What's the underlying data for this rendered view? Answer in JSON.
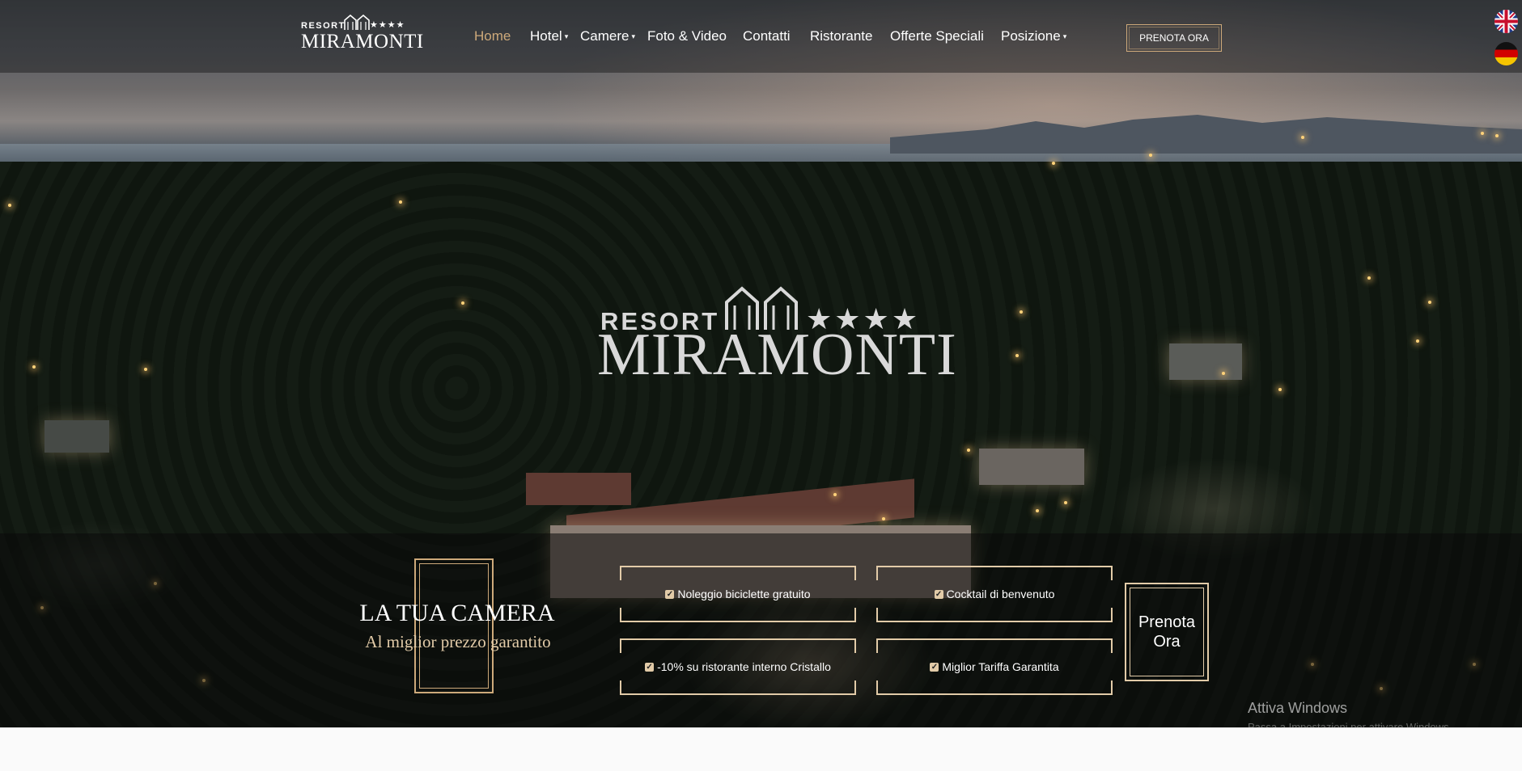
{
  "brand": {
    "resort": "RESORT",
    "stars": "★★★★",
    "name": "MIRAMONTI"
  },
  "nav": {
    "home": "Home",
    "hotel": "Hotel",
    "camere": "Camere",
    "foto": "Foto & Video",
    "contatti": "Contatti",
    "ristorante": "Ristorante",
    "offerte": "Offerte Speciali",
    "posizione": "Posizione",
    "caret": "▾",
    "book_label": "PRENOTA ORA"
  },
  "hero_logo": {
    "resort": "RESORT",
    "stars": "★★★★",
    "name": "MIRAMONTI"
  },
  "promo": {
    "title": "LA TUA CAMERA",
    "subtitle": "Al miglior prezzo garantito",
    "perks": [
      "Noleggio biciclette gratuito",
      "Cocktail di benvenuto",
      "-10% su ristorante interno Cristallo",
      "Miglior Tariffa Garantita"
    ],
    "check": "✓",
    "book_line1": "Prenota",
    "book_line2": "Ora"
  },
  "windows_watermark": {
    "title": "Attiva Windows",
    "subtitle": "Passa a Impostazioni per attivare Windows."
  },
  "colors": {
    "accent": "#cda97a",
    "gold_light": "#e2cba8"
  }
}
